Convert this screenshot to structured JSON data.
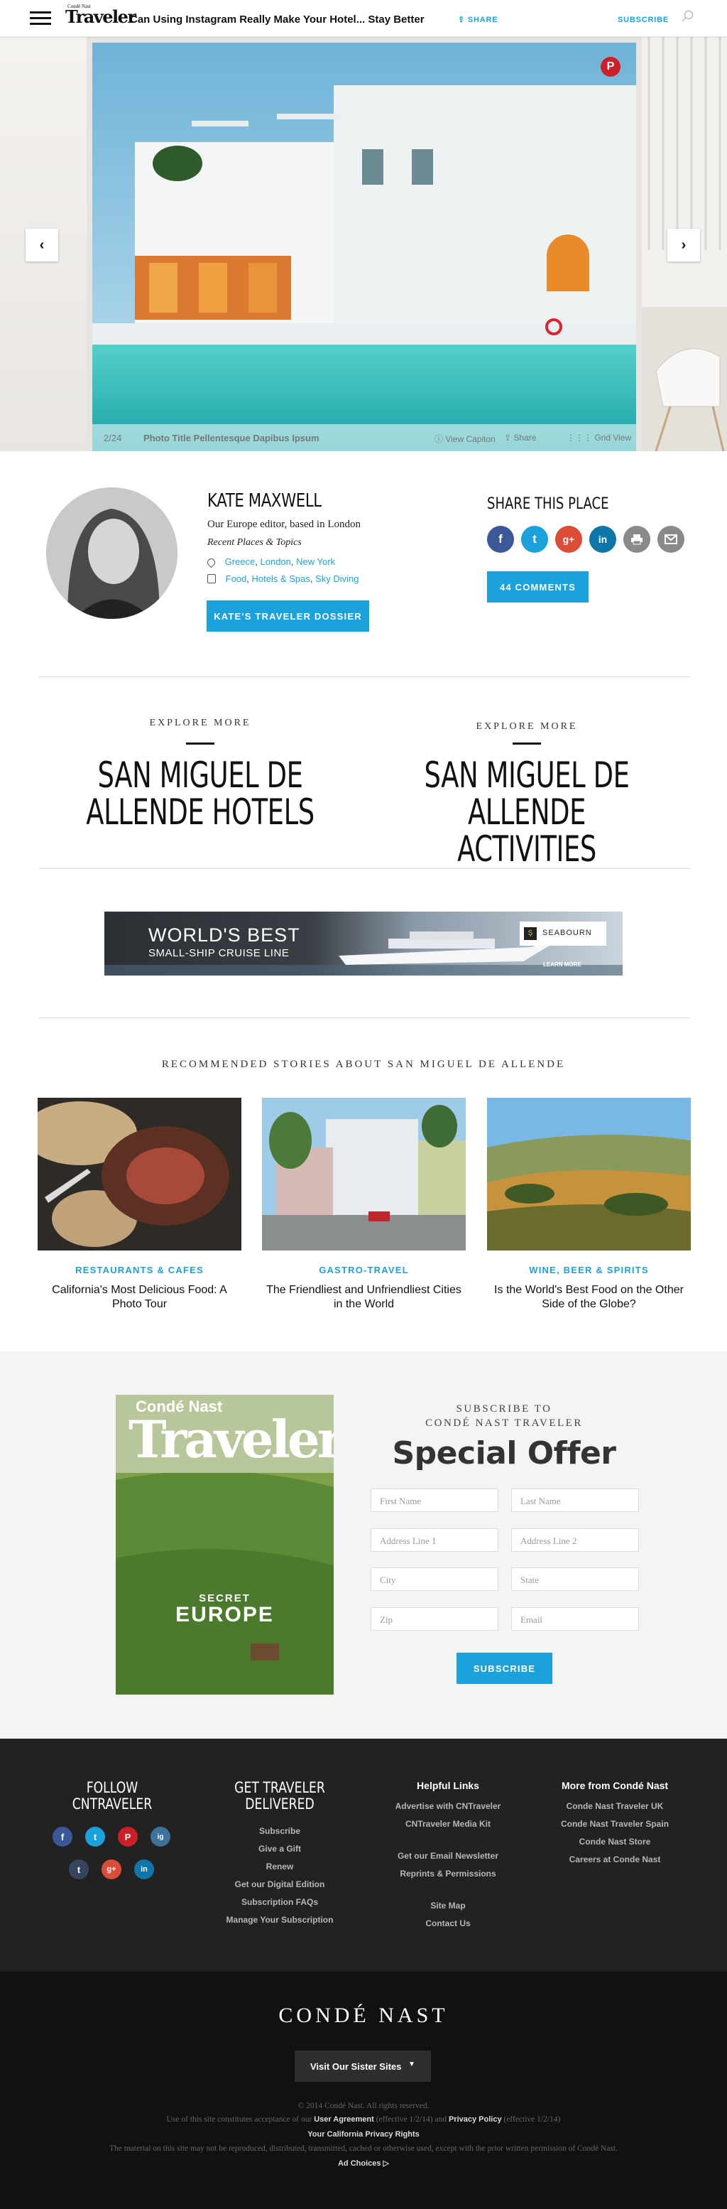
{
  "header": {
    "brand_small": "Condé Nast",
    "brand": "Traveler",
    "title": "Can Using Instagram Really Make Your Hotel... Stay Better",
    "share_label": "SHARE",
    "subscribe_label": "SUBSCRIBE"
  },
  "gallery": {
    "counter": "2/24",
    "caption": "Photo Title Pellentesque Dapibus Ipsum",
    "view_caption": "View Capiton",
    "share": "Share",
    "grid_view": "Grid View",
    "prev_glyph": "‹",
    "next_glyph": "›",
    "pinterest_glyph": "P"
  },
  "author": {
    "name": "KATE MAXWELL",
    "bio": "Our Europe editor, based in London",
    "recent": "Recent Places & Topics",
    "places": [
      "Greece",
      "London",
      "New York"
    ],
    "topics": [
      "Food",
      "Hotels & Spas",
      "Sky Diving"
    ],
    "dossier_button": "KATE'S TRAVELER DOSSIER"
  },
  "share": {
    "heading": "SHARE THIS PLACE",
    "icons": [
      "f",
      "t",
      "g+",
      "in",
      "print",
      "mail"
    ],
    "comments_button": "44 COMMENTS"
  },
  "explore": [
    {
      "kicker": "EXPLORE MORE",
      "title_line1": "SAN MIGUEL DE",
      "title_line2": "ALLENDE HOTELS"
    },
    {
      "kicker": "EXPLORE MORE",
      "title_line1": "SAN MIGUEL DE",
      "title_line2": "ALLENDE ACTIVITIES"
    }
  ],
  "ad": {
    "line1": "WORLD'S BEST",
    "line2": "SMALL-SHIP CRUISE LINE",
    "brand": "SEABOURN",
    "cta": "LEARN MORE"
  },
  "recommended": {
    "heading": "RECOMMENDED STORIES ABOUT SAN MIGUEL DE ALLENDE",
    "items": [
      {
        "category": "RESTAURANTS & CAFES",
        "title": "California's Most Delicious Food: A Photo Tour"
      },
      {
        "category": "GASTRO-TRAVEL",
        "title": "The Friendliest and Unfriendliest Cities in the World"
      },
      {
        "category": "WINE, BEER & SPIRITS",
        "title": "Is the World's Best Food on the Other Side of the Globe?"
      }
    ]
  },
  "subscribe": {
    "kicker1": "SUBSCRIBE TO",
    "kicker2": "CONDÉ NAST TRAVELER",
    "offer": "Special Offer",
    "fields": {
      "first_name": "First Name",
      "last_name": "Last Name",
      "address1": "Address Line 1",
      "address2": "Address Line 2",
      "city": "City",
      "state": "State",
      "zip": "Zip",
      "email": "Email"
    },
    "button": "SUBSCRIBE",
    "magazine": {
      "brand_small": "Condé Nast",
      "brand": "Traveler",
      "cover_line1": "SECRET",
      "cover_line2": "EUROPE"
    }
  },
  "footer": {
    "follow_line1": "FOLLOW",
    "follow_line2": "CNTRAVELER",
    "social": [
      "f",
      "t",
      "P",
      "ig",
      "t",
      "g+",
      "in"
    ],
    "delivered_line1": "GET TRAVELER",
    "delivered_line2": "DELIVERED",
    "delivered_links": [
      "Subscribe",
      "Give a Gift",
      "Renew",
      "Get our Digital Edition",
      "Subscription FAQs",
      "Manage Your Subscription"
    ],
    "helpful_heading": "Helpful Links",
    "helpful_links": [
      "Advertise with CNTraveler",
      "CNTraveler Media Kit",
      "Get our Email Newsletter",
      "Reprints & Permissions",
      "Site Map",
      "Contact Us"
    ],
    "more_heading": "More from Condé Nast",
    "more_links": [
      "Conde Nast Traveler UK",
      "Conde Nast Traveler Spain",
      "Conde Nast Store",
      "Careers at Conde Nast"
    ],
    "logo": "CONDÉ NAST",
    "sister_label": "Visit Our Sister Sites",
    "copyright": "© 2014 Condé Nast. All rights reserved.",
    "use_prefix": "Use of this site constitutes acceptance of our",
    "user_agreement": "User Agreement",
    "ua_date": "(effective 1/2/14) and",
    "privacy": "Privacy Policy",
    "privacy_date": "(effective 1/2/14)",
    "california": "Your California Privacy Rights",
    "material": "The material on this site may not be reproduced, distributed, transmitted, cached or otherwise used, except with the prior written permission of Condé Nast.",
    "ad_choices": "Ad Choices ▷"
  },
  "colors": {
    "accent": "#1ba2dc",
    "footer_dark": "#222222",
    "footer_darker": "#111111"
  }
}
